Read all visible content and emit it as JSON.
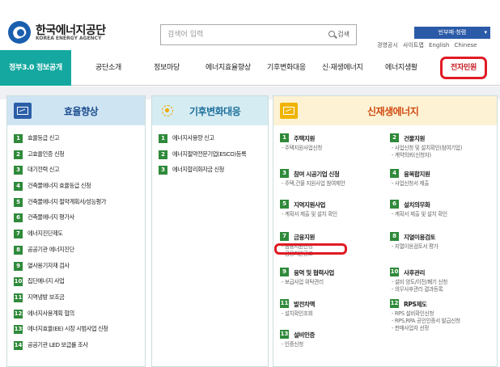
{
  "header": {
    "logo_ko": "한국에너지공단",
    "logo_en": "KOREA ENERGY AGENCY",
    "search_placeholder": "검색어 입력",
    "search_button": "검색",
    "site_select": "빈부패·청렴",
    "util_links": [
      "경영공시",
      "사이트맵",
      "English",
      "Chinese"
    ]
  },
  "nav": [
    "정부3.0 정보공개",
    "공단소개",
    "정보마당",
    "에너지효율향상",
    "기후변화대응",
    "신·재생에너지",
    "에너지생활",
    "전자민원"
  ],
  "panels": {
    "efficiency": {
      "title": "효율향상",
      "items": [
        "효율등급 신고",
        "고효율인증 신청",
        "대기전력 신고",
        "건축물에너지 효율등급 신청",
        "건축물에너지 절약계획서/성능평가",
        "건축물에너지 평가사",
        "에너지진단제도",
        "공공기관 에너지진단",
        "열사용기자재 검사",
        "집단에너지 사업",
        "지역냉방 보조금",
        "에너지사용계획 협의",
        "에너지효율(EE) 시장 시범사업 신청",
        "공공기관 LED 보급률 조사"
      ]
    },
    "climate": {
      "title": "기후변화대응",
      "items": [
        "에너지사용량 신고",
        "에너지절약전문기업(ESCO)등록",
        "에너지합리화자금 신청"
      ]
    },
    "renewable": {
      "title": "신재생에너지",
      "cells": [
        {
          "num": "1",
          "title": "주택지원",
          "subs": [
            "- 주택지원사업신청"
          ]
        },
        {
          "num": "2",
          "title": "건물지원",
          "subs": [
            "- 사업신청 및 설치확인(참여기업)",
            "- 계약의뢰(신청자)"
          ]
        },
        {
          "num": "3",
          "title": "참여 시공기업 신청",
          "subs": [
            "- 주택,건물 지원사업 참여제안"
          ]
        },
        {
          "num": "4",
          "title": "융복합지원",
          "subs": [
            "- 사업신청서 제출"
          ]
        },
        {
          "num": "5",
          "title": "지역지원사업",
          "subs": [
            "- 계획서 제출 및 설치 확인"
          ]
        },
        {
          "num": "6",
          "title": "설치의무화",
          "subs": [
            "- 계획서 제출 및 설치 확인"
          ]
        },
        {
          "num": "7",
          "title": "금융지원",
          "subs": [
            "- 금융지원신청",
            "- 금융지원공고"
          ]
        },
        {
          "num": "8",
          "title": "지열이용검토",
          "subs": [
            "- 지열이용검토서 평가"
          ]
        },
        {
          "num": "9",
          "title": "융역 및 협력사업",
          "subs": [
            "- 보급사업 위탁관리"
          ]
        },
        {
          "num": "10",
          "title": "사후관리",
          "subs": [
            "- 설비 양도/이전/폐기 신청",
            "- 의무사후관리 결과등록"
          ]
        },
        {
          "num": "11",
          "title": "발전차액",
          "subs": [
            "- 설치확인조회"
          ]
        },
        {
          "num": "12",
          "title": "RPS제도",
          "subs": [
            "- RPS 설비확인신청",
            "- RPS,RPA 공인인증서 발급신청",
            "- 판매사업자 선정"
          ]
        },
        {
          "num": "13",
          "title": "설비인증",
          "subs": [
            "- 인증신청"
          ]
        }
      ]
    }
  },
  "colors": {
    "teal": "#14a8a0",
    "green_badge": "#2f8a3a",
    "highlight_red": "#e01b24",
    "blue": "#2b5ba8"
  }
}
